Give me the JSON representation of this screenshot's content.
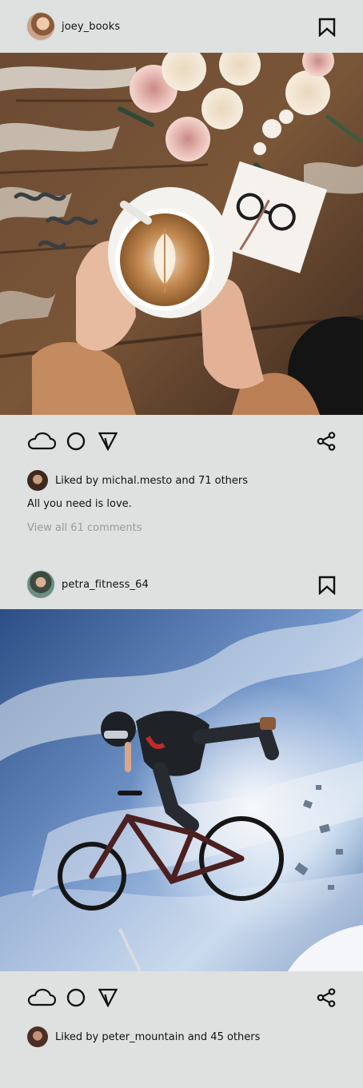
{
  "posts": [
    {
      "username": "joey_books",
      "image_alt": "Hands holding latte coffee cup on rustic table with roses and glasses",
      "likes_text": "Liked by michal.mesto and 71 others",
      "caption": "All you need is love.",
      "comments_link": "View all 61 comments",
      "icons": {
        "avatar": "avatar",
        "bookmark": "bookmark-icon",
        "like": "cloud-like-icon",
        "comment": "circle-comment-icon",
        "send": "send-icon",
        "share": "share-icon"
      }
    },
    {
      "username": "petra_fitness_64",
      "image_alt": "BMX rider doing a jump against a dramatic blue sky",
      "likes_text": "Liked by peter_mountain and 45 others",
      "icons": {
        "avatar": "avatar",
        "bookmark": "bookmark-icon",
        "like": "cloud-like-icon",
        "comment": "circle-comment-icon",
        "send": "send-icon",
        "share": "share-icon"
      }
    }
  ],
  "colors": {
    "background": "#dfe1e1",
    "muted_text": "#9a9a9a"
  }
}
